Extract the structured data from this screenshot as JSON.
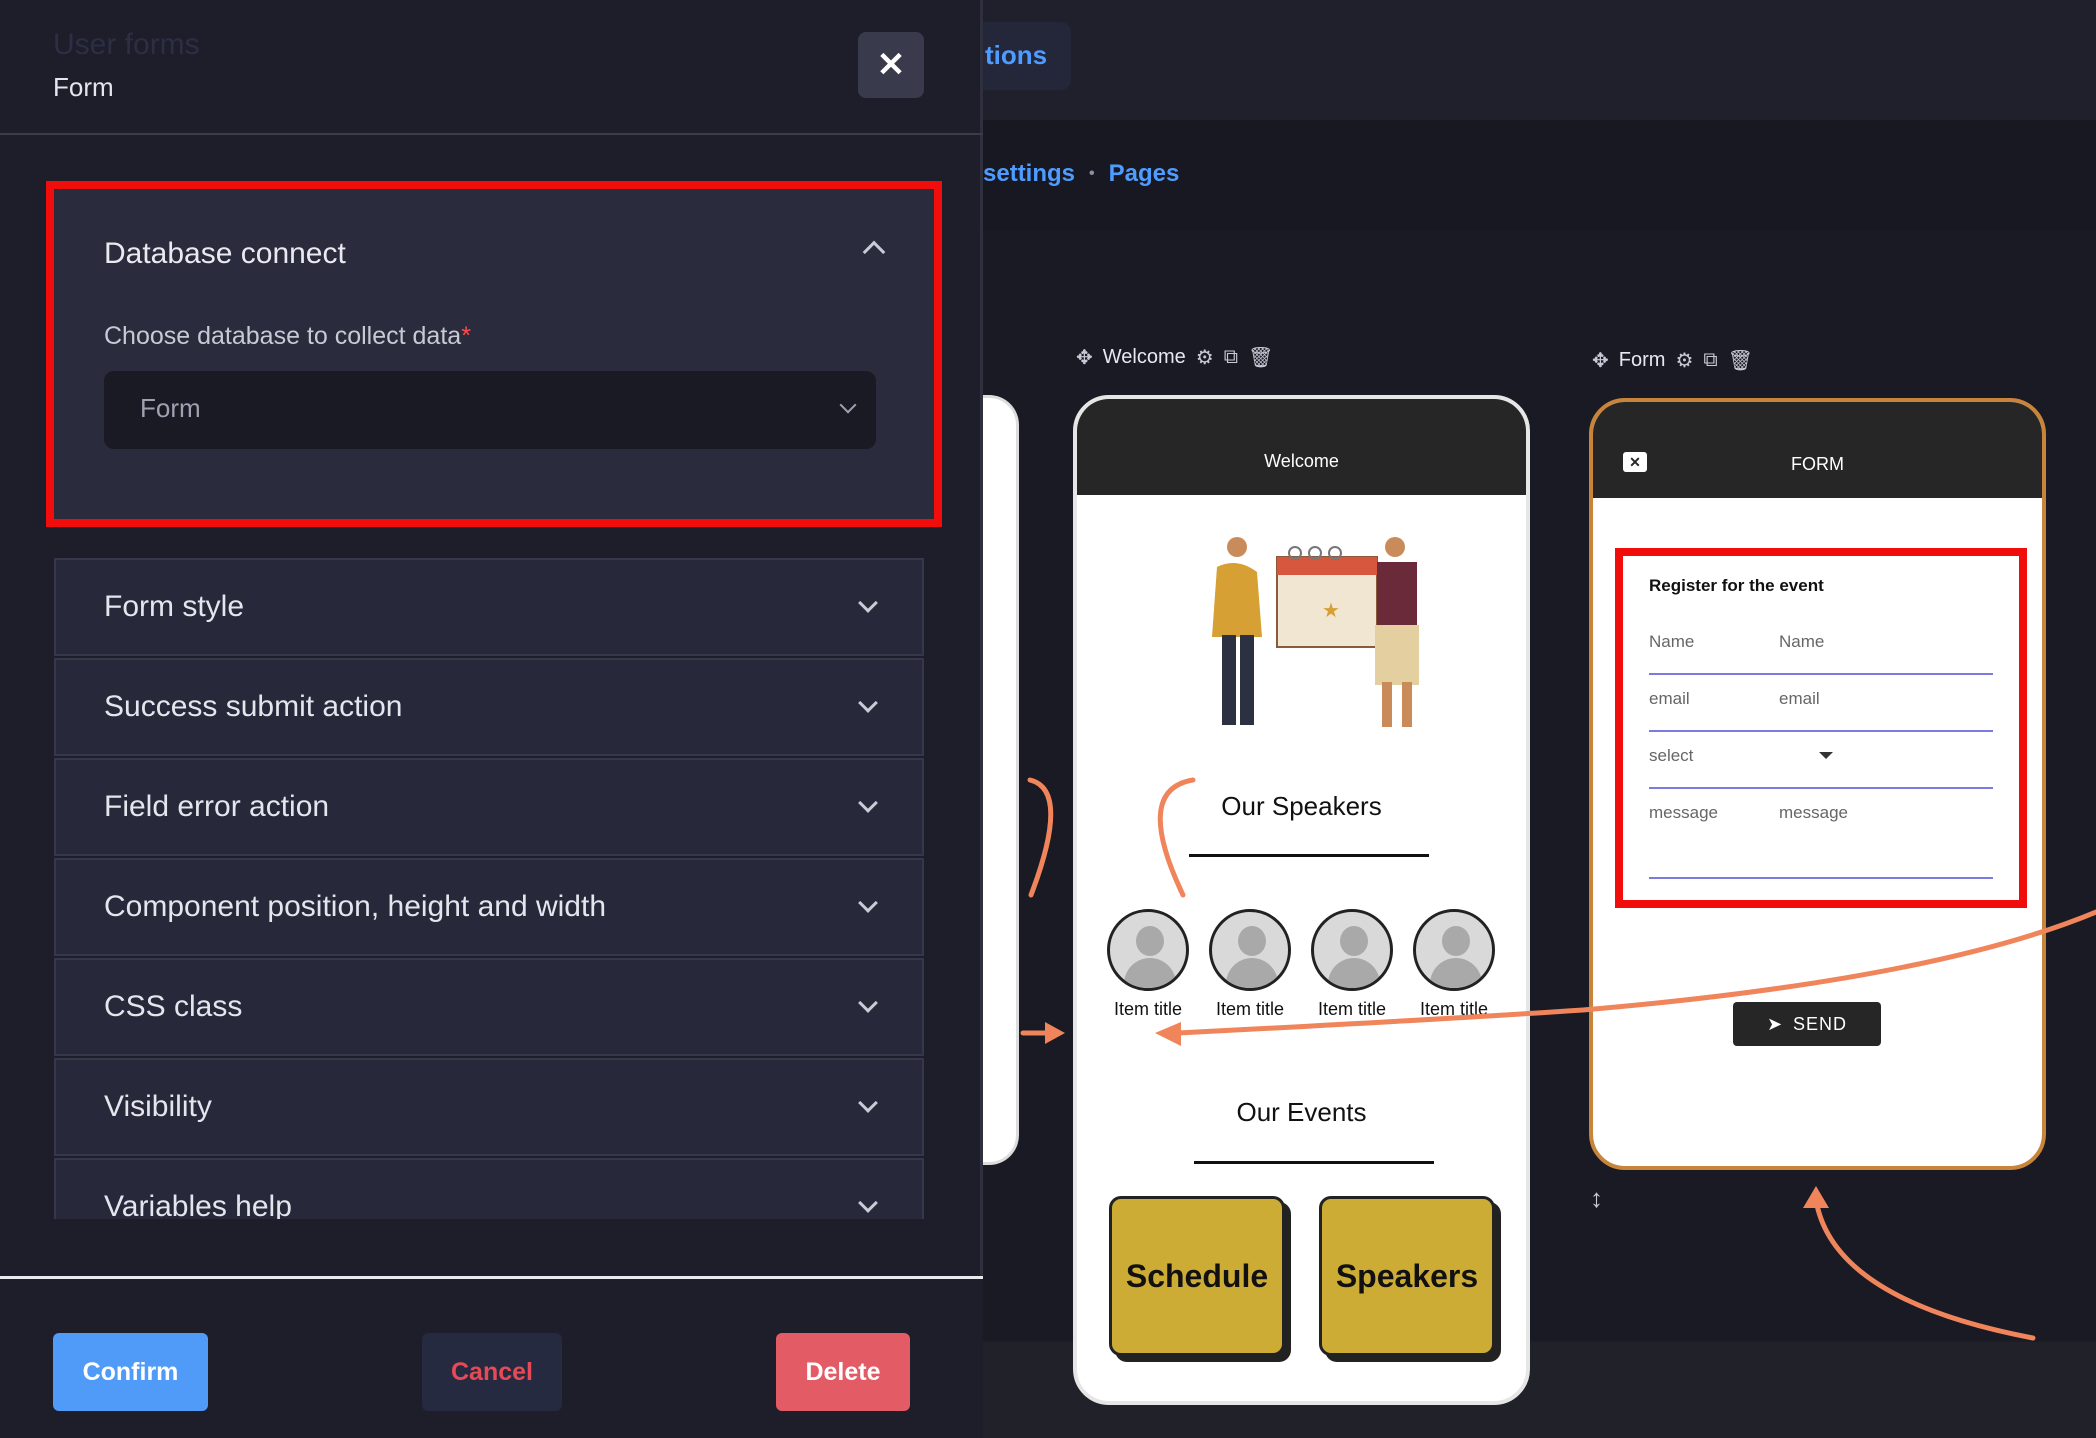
{
  "background_app": {
    "tab_label": "tions",
    "breadcrumbs": [
      "settings",
      "Pages"
    ],
    "screens": {
      "welcome": {
        "label": "Welcome",
        "header": "Welcome",
        "speakers_title": "Our Speakers",
        "speaker_items": [
          "Item title",
          "Item title",
          "Item title",
          "Item title"
        ],
        "events_title": "Our Events",
        "cards": [
          "Schedule",
          "Speakers"
        ]
      },
      "form": {
        "label": "Form",
        "header": "FORM",
        "form_title": "Register for the event",
        "fields": [
          {
            "label": "Name",
            "placeholder": "Name"
          },
          {
            "label": "email",
            "placeholder": "email"
          },
          {
            "label": "select",
            "placeholder": ""
          },
          {
            "label": "message",
            "placeholder": "message"
          }
        ],
        "send_label": "SEND"
      }
    },
    "colors": {
      "accent_link": "#4e9cff",
      "arrow": "#f0845a",
      "highlight": "#f20d0d",
      "frame_active": "#c8843a"
    }
  },
  "modal": {
    "title": "User forms",
    "subtitle": "Form",
    "close_icon": "close-icon",
    "database_section": {
      "title": "Database connect",
      "field_label": "Choose database to collect data",
      "required_mark": "*",
      "selected_value": "Form"
    },
    "accordions": [
      "Form style",
      "Success submit action",
      "Field error action",
      "Component position, height and width",
      "CSS class",
      "Visibility",
      "Variables help"
    ],
    "footer": {
      "confirm": "Confirm",
      "cancel": "Cancel",
      "delete": "Delete"
    },
    "colors": {
      "confirm": "#4f9bf7",
      "delete": "#e25b65",
      "cancel_text": "#e64a57"
    }
  }
}
